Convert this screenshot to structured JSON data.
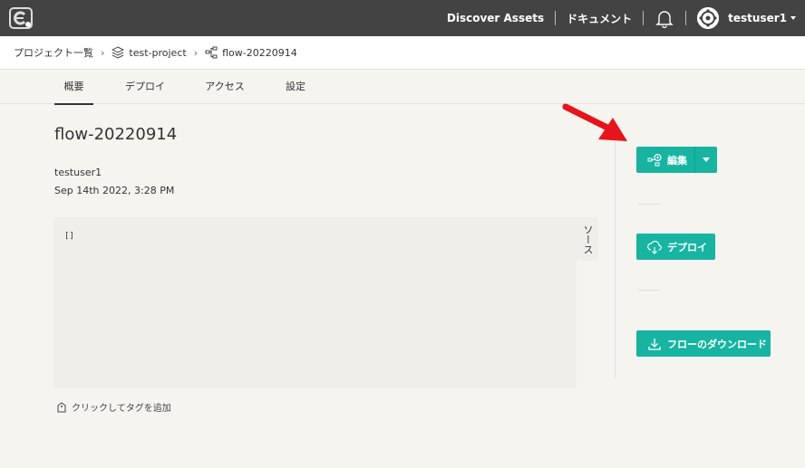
{
  "topbar": {
    "discover_assets": "Discover Assets",
    "documents": "ドキュメント",
    "username": "testuser1"
  },
  "breadcrumb": {
    "projects": "プロジェクト一覧",
    "project": "test-project",
    "flow": "flow-20220914"
  },
  "tabs": [
    {
      "label": "概要"
    },
    {
      "label": "デプロイ"
    },
    {
      "label": "アクセス"
    },
    {
      "label": "設定"
    }
  ],
  "detail": {
    "title": "flow-20220914",
    "author": "testuser1",
    "date": "Sep 14th 2022, 3:28 PM",
    "code": "[]",
    "source_tab": "ソース",
    "add_tag": "クリックしてタグを追加"
  },
  "actions": {
    "edit": "編集",
    "deploy": "デプロイ",
    "download": "フローのダウンロード"
  },
  "colors": {
    "accent": "#17b4a2",
    "topbar": "#434343",
    "annotation_arrow": "#e8141b"
  },
  "icons": [
    "logo-icon",
    "bell-icon",
    "avatar-icon",
    "layers-icon",
    "flow-icon",
    "tag-icon",
    "edit-flow-icon",
    "deploy-icon",
    "download-icon"
  ]
}
